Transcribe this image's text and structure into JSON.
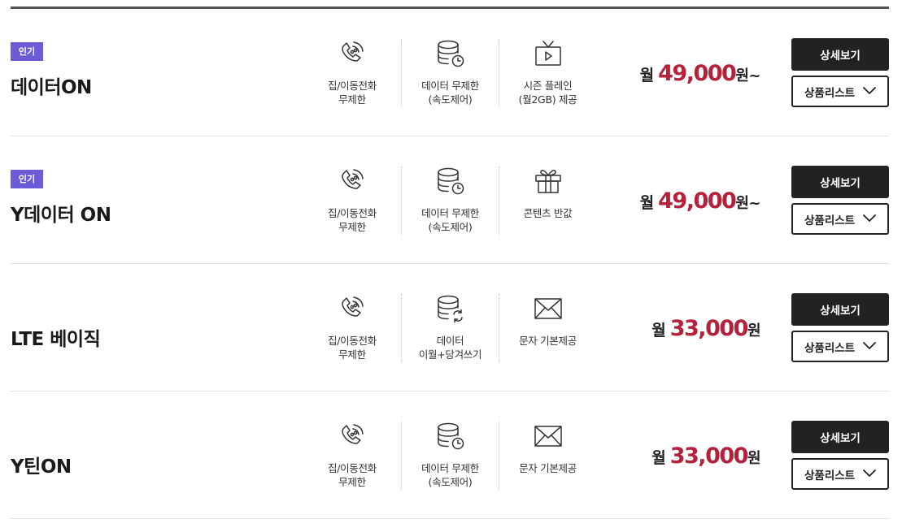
{
  "plans": [
    {
      "badge": "인기",
      "name": "데이터ON",
      "features": [
        {
          "icon": "phone-icon",
          "text": "집/이동전화\n무제한"
        },
        {
          "icon": "data-clock-icon",
          "text": "데이터 무제한\n(속도제어)"
        },
        {
          "icon": "tv-play-icon",
          "text": "시즌 플레인\n(월2GB) 제공"
        }
      ],
      "price_prefix": "월",
      "price_amount": "49,000",
      "price_suffix": "원~",
      "detail_label": "상세보기",
      "list_label": "상품리스트"
    },
    {
      "badge": "인기",
      "name": "Y데이터 ON",
      "features": [
        {
          "icon": "phone-icon",
          "text": "집/이동전화\n무제한"
        },
        {
          "icon": "data-clock-icon",
          "text": "데이터 무제한\n(속도제어)"
        },
        {
          "icon": "gift-icon",
          "text": "콘텐츠 반값"
        }
      ],
      "price_prefix": "월",
      "price_amount": "49,000",
      "price_suffix": "원~",
      "detail_label": "상세보기",
      "list_label": "상품리스트"
    },
    {
      "badge": "",
      "name": "LTE 베이직",
      "features": [
        {
          "icon": "phone-icon",
          "text": "집/이동전화\n무제한"
        },
        {
          "icon": "data-refresh-icon",
          "text": "데이터\n이월+당겨쓰기"
        },
        {
          "icon": "envelope-icon",
          "text": "문자 기본제공"
        }
      ],
      "price_prefix": "월",
      "price_amount": "33,000",
      "price_suffix": "원",
      "detail_label": "상세보기",
      "list_label": "상품리스트"
    },
    {
      "badge": "",
      "name": "Y틴ON",
      "features": [
        {
          "icon": "phone-icon",
          "text": "집/이동전화\n무제한"
        },
        {
          "icon": "data-clock-icon",
          "text": "데이터 무제한\n(속도제어)"
        },
        {
          "icon": "envelope-icon",
          "text": "문자 기본제공"
        }
      ],
      "price_prefix": "월",
      "price_amount": "33,000",
      "price_suffix": "원",
      "detail_label": "상세보기",
      "list_label": "상품리스트"
    }
  ],
  "colors": {
    "badge": "#6b5bd6",
    "price": "#b5213a",
    "button_dark": "#222222"
  }
}
